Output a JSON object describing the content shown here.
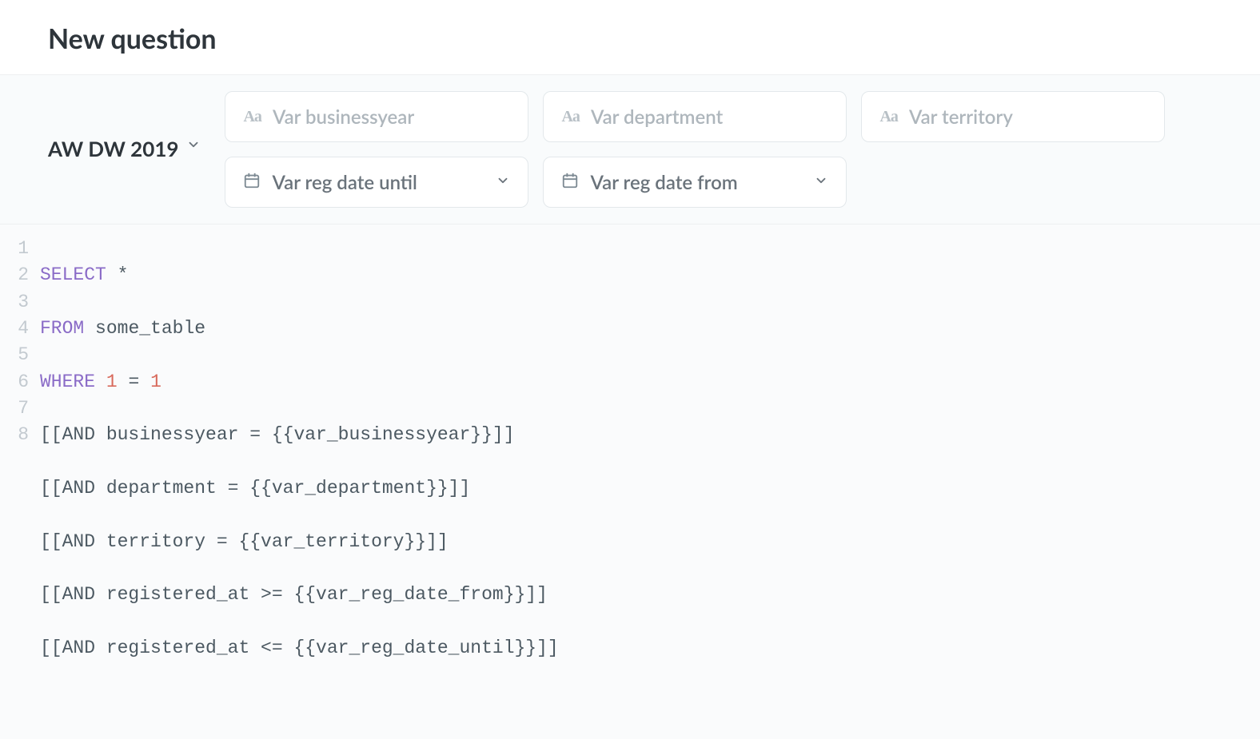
{
  "header": {
    "title": "New question"
  },
  "db_selector": {
    "label": "AW DW 2019"
  },
  "filters": {
    "businessyear": {
      "placeholder": "Var businessyear",
      "type": "text"
    },
    "department": {
      "placeholder": "Var department",
      "type": "text"
    },
    "territory": {
      "placeholder": "Var territory",
      "type": "text"
    },
    "reg_until": {
      "placeholder": "Var reg date until",
      "type": "date"
    },
    "reg_from": {
      "placeholder": "Var reg date from",
      "type": "date"
    }
  },
  "sql": {
    "lines": [
      "1",
      "2",
      "3",
      "4",
      "5",
      "6",
      "7",
      "8"
    ],
    "tokens": {
      "select": "SELECT",
      "star": "*",
      "from": "FROM",
      "some_table": "some_table",
      "where": "WHERE",
      "one_a": "1",
      "eq": "=",
      "one_b": "1",
      "l4": "[[AND businessyear = {{var_businessyear}}]]",
      "l5": "[[AND department = {{var_department}}]]",
      "l6": "[[AND territory = {{var_territory}}]]",
      "l7": "[[AND registered_at >= {{var_reg_date_from}}]]",
      "l8": "[[AND registered_at <= {{var_reg_date_until}}]]"
    }
  }
}
